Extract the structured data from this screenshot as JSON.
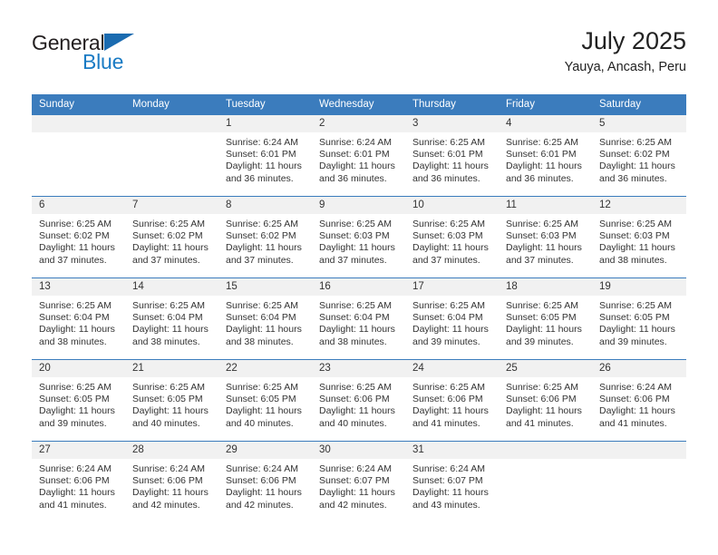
{
  "brand": {
    "word_general": "General",
    "word_blue": "Blue",
    "triangle_color": "#1a6bb0",
    "blue_color": "#1a7bc4"
  },
  "header": {
    "title": "July 2025",
    "subtitle": "Yauya, Ancash, Peru"
  },
  "theme": {
    "header_blue": "#3b7cbd",
    "daynum_band": "#f1f1f1",
    "text": "#333333"
  },
  "calendar": {
    "weekday_headers": [
      "Sunday",
      "Monday",
      "Tuesday",
      "Wednesday",
      "Thursday",
      "Friday",
      "Saturday"
    ],
    "labels": {
      "sunrise": "Sunrise:",
      "sunset": "Sunset:",
      "daylight": "Daylight:"
    },
    "weeks": [
      [
        {
          "day": "",
          "empty": true
        },
        {
          "day": "",
          "empty": true
        },
        {
          "day": "1",
          "sunrise": "Sunrise: 6:24 AM",
          "sunset": "Sunset: 6:01 PM",
          "daylight": "Daylight: 11 hours and 36 minutes."
        },
        {
          "day": "2",
          "sunrise": "Sunrise: 6:24 AM",
          "sunset": "Sunset: 6:01 PM",
          "daylight": "Daylight: 11 hours and 36 minutes."
        },
        {
          "day": "3",
          "sunrise": "Sunrise: 6:25 AM",
          "sunset": "Sunset: 6:01 PM",
          "daylight": "Daylight: 11 hours and 36 minutes."
        },
        {
          "day": "4",
          "sunrise": "Sunrise: 6:25 AM",
          "sunset": "Sunset: 6:01 PM",
          "daylight": "Daylight: 11 hours and 36 minutes."
        },
        {
          "day": "5",
          "sunrise": "Sunrise: 6:25 AM",
          "sunset": "Sunset: 6:02 PM",
          "daylight": "Daylight: 11 hours and 36 minutes."
        }
      ],
      [
        {
          "day": "6",
          "sunrise": "Sunrise: 6:25 AM",
          "sunset": "Sunset: 6:02 PM",
          "daylight": "Daylight: 11 hours and 37 minutes."
        },
        {
          "day": "7",
          "sunrise": "Sunrise: 6:25 AM",
          "sunset": "Sunset: 6:02 PM",
          "daylight": "Daylight: 11 hours and 37 minutes."
        },
        {
          "day": "8",
          "sunrise": "Sunrise: 6:25 AM",
          "sunset": "Sunset: 6:02 PM",
          "daylight": "Daylight: 11 hours and 37 minutes."
        },
        {
          "day": "9",
          "sunrise": "Sunrise: 6:25 AM",
          "sunset": "Sunset: 6:03 PM",
          "daylight": "Daylight: 11 hours and 37 minutes."
        },
        {
          "day": "10",
          "sunrise": "Sunrise: 6:25 AM",
          "sunset": "Sunset: 6:03 PM",
          "daylight": "Daylight: 11 hours and 37 minutes."
        },
        {
          "day": "11",
          "sunrise": "Sunrise: 6:25 AM",
          "sunset": "Sunset: 6:03 PM",
          "daylight": "Daylight: 11 hours and 37 minutes."
        },
        {
          "day": "12",
          "sunrise": "Sunrise: 6:25 AM",
          "sunset": "Sunset: 6:03 PM",
          "daylight": "Daylight: 11 hours and 38 minutes."
        }
      ],
      [
        {
          "day": "13",
          "sunrise": "Sunrise: 6:25 AM",
          "sunset": "Sunset: 6:04 PM",
          "daylight": "Daylight: 11 hours and 38 minutes."
        },
        {
          "day": "14",
          "sunrise": "Sunrise: 6:25 AM",
          "sunset": "Sunset: 6:04 PM",
          "daylight": "Daylight: 11 hours and 38 minutes."
        },
        {
          "day": "15",
          "sunrise": "Sunrise: 6:25 AM",
          "sunset": "Sunset: 6:04 PM",
          "daylight": "Daylight: 11 hours and 38 minutes."
        },
        {
          "day": "16",
          "sunrise": "Sunrise: 6:25 AM",
          "sunset": "Sunset: 6:04 PM",
          "daylight": "Daylight: 11 hours and 38 minutes."
        },
        {
          "day": "17",
          "sunrise": "Sunrise: 6:25 AM",
          "sunset": "Sunset: 6:04 PM",
          "daylight": "Daylight: 11 hours and 39 minutes."
        },
        {
          "day": "18",
          "sunrise": "Sunrise: 6:25 AM",
          "sunset": "Sunset: 6:05 PM",
          "daylight": "Daylight: 11 hours and 39 minutes."
        },
        {
          "day": "19",
          "sunrise": "Sunrise: 6:25 AM",
          "sunset": "Sunset: 6:05 PM",
          "daylight": "Daylight: 11 hours and 39 minutes."
        }
      ],
      [
        {
          "day": "20",
          "sunrise": "Sunrise: 6:25 AM",
          "sunset": "Sunset: 6:05 PM",
          "daylight": "Daylight: 11 hours and 39 minutes."
        },
        {
          "day": "21",
          "sunrise": "Sunrise: 6:25 AM",
          "sunset": "Sunset: 6:05 PM",
          "daylight": "Daylight: 11 hours and 40 minutes."
        },
        {
          "day": "22",
          "sunrise": "Sunrise: 6:25 AM",
          "sunset": "Sunset: 6:05 PM",
          "daylight": "Daylight: 11 hours and 40 minutes."
        },
        {
          "day": "23",
          "sunrise": "Sunrise: 6:25 AM",
          "sunset": "Sunset: 6:06 PM",
          "daylight": "Daylight: 11 hours and 40 minutes."
        },
        {
          "day": "24",
          "sunrise": "Sunrise: 6:25 AM",
          "sunset": "Sunset: 6:06 PM",
          "daylight": "Daylight: 11 hours and 41 minutes."
        },
        {
          "day": "25",
          "sunrise": "Sunrise: 6:25 AM",
          "sunset": "Sunset: 6:06 PM",
          "daylight": "Daylight: 11 hours and 41 minutes."
        },
        {
          "day": "26",
          "sunrise": "Sunrise: 6:24 AM",
          "sunset": "Sunset: 6:06 PM",
          "daylight": "Daylight: 11 hours and 41 minutes."
        }
      ],
      [
        {
          "day": "27",
          "sunrise": "Sunrise: 6:24 AM",
          "sunset": "Sunset: 6:06 PM",
          "daylight": "Daylight: 11 hours and 41 minutes."
        },
        {
          "day": "28",
          "sunrise": "Sunrise: 6:24 AM",
          "sunset": "Sunset: 6:06 PM",
          "daylight": "Daylight: 11 hours and 42 minutes."
        },
        {
          "day": "29",
          "sunrise": "Sunrise: 6:24 AM",
          "sunset": "Sunset: 6:06 PM",
          "daylight": "Daylight: 11 hours and 42 minutes."
        },
        {
          "day": "30",
          "sunrise": "Sunrise: 6:24 AM",
          "sunset": "Sunset: 6:07 PM",
          "daylight": "Daylight: 11 hours and 42 minutes."
        },
        {
          "day": "31",
          "sunrise": "Sunrise: 6:24 AM",
          "sunset": "Sunset: 6:07 PM",
          "daylight": "Daylight: 11 hours and 43 minutes."
        },
        {
          "day": "",
          "empty": true
        },
        {
          "day": "",
          "empty": true
        }
      ]
    ]
  }
}
